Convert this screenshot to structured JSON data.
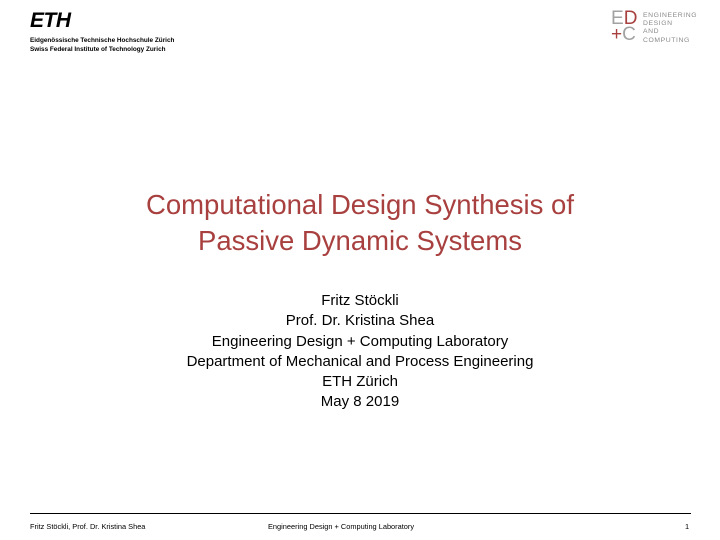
{
  "header": {
    "eth_logo": "ETH",
    "institution_de": "Eidgenössische Technische Hochschule Zürich",
    "institution_en": "Swiss Federal Institute of Technology Zurich",
    "lab_logo": {
      "line1_left": "E",
      "line1_right": "D",
      "line2_left": "+",
      "line2_right": "C",
      "words": [
        "ENGINEERING",
        "DESIGN",
        "AND",
        "COMPUTING"
      ],
      "gray_color": "#a2a2a2",
      "accent_color": "#a8403f"
    }
  },
  "title": {
    "line1": "Computational Design Synthesis of",
    "line2": "Passive Dynamic Systems",
    "color": "#a8403f"
  },
  "authors": {
    "lines": [
      "Fritz Stöckli",
      "Prof. Dr. Kristina Shea",
      "Engineering Design + Computing Laboratory",
      "Department of Mechanical and Process Engineering",
      "ETH Zürich",
      "May 8 2019"
    ]
  },
  "footer": {
    "left": "Fritz Stöckli, Prof. Dr. Kristina Shea",
    "center": "Engineering  Design + Computing Laboratory",
    "page_number": "1"
  }
}
